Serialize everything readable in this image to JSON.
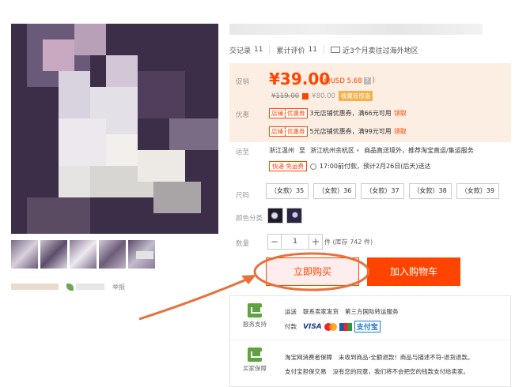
{
  "meta": {
    "trade_label": "交记录",
    "trade_count": "11",
    "review_label": "累计评价",
    "review_count": "11",
    "sold_abroad": "近3个月卖往过海外地区"
  },
  "price": {
    "label": "促销",
    "value": "¥39.00",
    "usd": "(约USD 5.68",
    "original": "¥119.00",
    "original_bonus": "¥80.00",
    "tag": "收藏有惊喜"
  },
  "coupons": {
    "label": "优惠",
    "items": [
      {
        "tag_a": "店铺",
        "tag_b": "优惠券",
        "text": "3元店铺优惠券，满66元可用",
        "get": "领取"
      },
      {
        "tag_a": "店铺",
        "tag_b": "优惠券",
        "text": "5元店铺优惠券，满99元可用",
        "get": "领取"
      }
    ]
  },
  "shipping": {
    "label": "运至",
    "from": "浙江温州",
    "to_word": "至",
    "to": "浙江杭州余杭区",
    "note": "商品直送境外，推荐淘宝直运/集运服务",
    "tag": "快递 免运费",
    "eta": "17:00前付款，预计2月26日(后天)送达"
  },
  "size": {
    "label": "尺码",
    "options": [
      "（女款）35",
      "（女款）36",
      "（女款）37",
      "（女款）38",
      "（女款）39"
    ]
  },
  "color": {
    "label": "颜色分类"
  },
  "quantity": {
    "label": "数量",
    "value": "1",
    "minus": "−",
    "plus": "+",
    "stock": "件 (库存 742 件)"
  },
  "actions": {
    "buy": "立即购买",
    "cart": "加入购物车"
  },
  "share": {
    "report": "举报"
  },
  "service": {
    "support_label": "服务支持",
    "promise_label": "买家保障",
    "line1": [
      "运送",
      "联系卖家发货",
      "第三方国际转运服务"
    ],
    "pay_label": "付款",
    "visa": "VISA",
    "alipay": "支付宝",
    "line3": [
      "淘宝网消费者保障",
      "未收到商品-全额退款！商品与描述不符-退货退款。"
    ],
    "line4": [
      "支付宝担保交易",
      "没有您的同意，我们将不会把您的钱款支付给卖家。"
    ]
  },
  "colors": {
    "accent": "#ff4400",
    "price_bg": "#fdeee3",
    "annotation": "#e8703a"
  }
}
